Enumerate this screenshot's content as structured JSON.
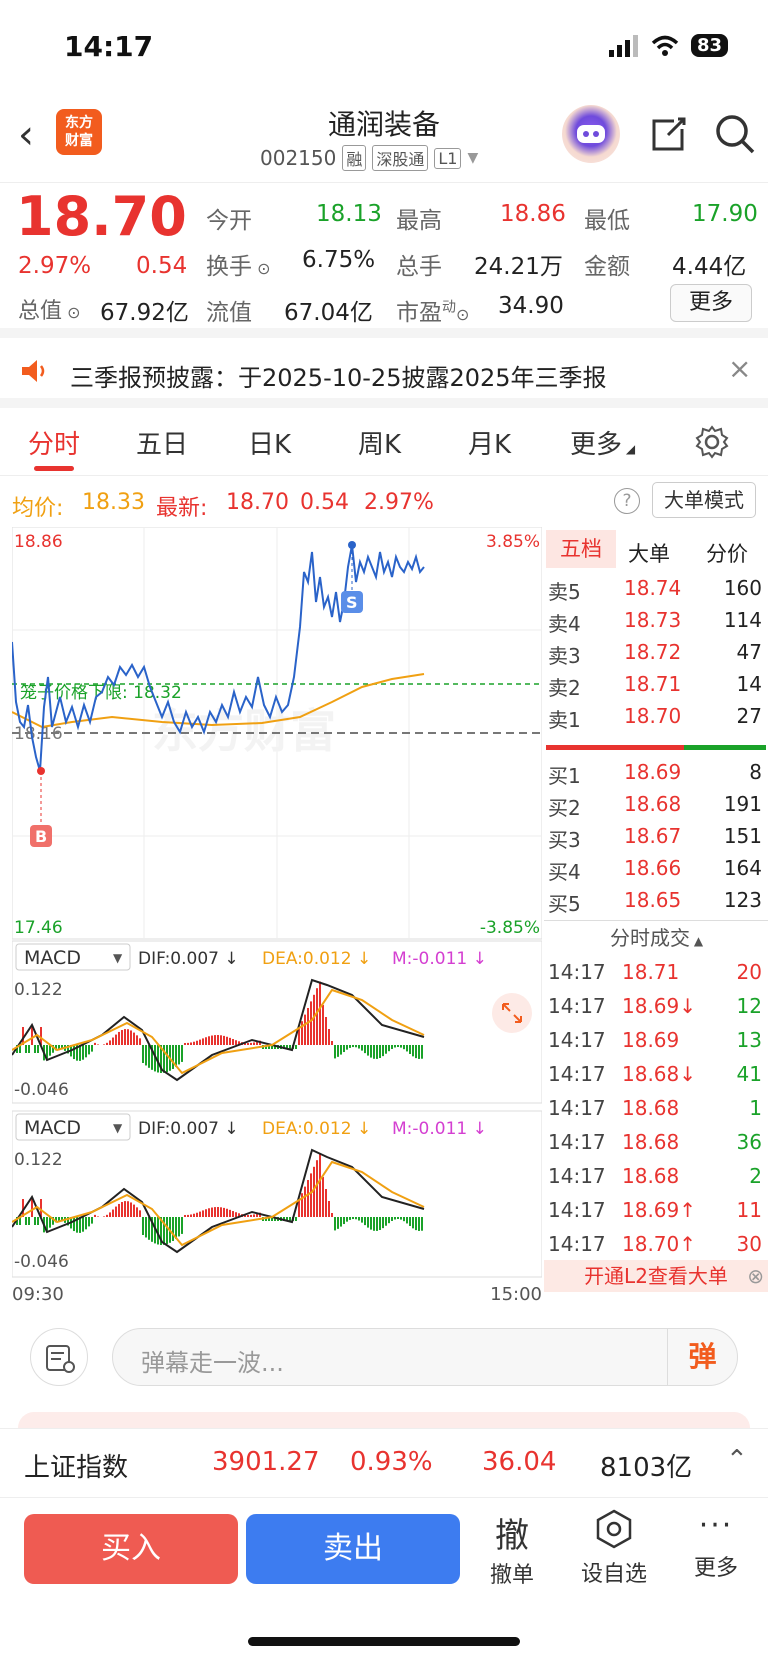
{
  "status": {
    "time": "14:17",
    "battery": "83"
  },
  "header": {
    "logo_line1": "东方",
    "logo_line2": "财富",
    "name": "通润装备",
    "code": "002150",
    "tags": [
      "融",
      "深股通",
      "L1"
    ]
  },
  "quote": {
    "price": "18.70",
    "pct": "2.97%",
    "chg": "0.54",
    "open_label": "今开",
    "open": "18.13",
    "high_label": "最高",
    "high": "18.86",
    "low_label": "最低",
    "low": "17.90",
    "turnover_label": "换手",
    "turnover": "6.75%",
    "volume_label": "总手",
    "volume": "24.21万",
    "amount_label": "金额",
    "amount": "4.44亿",
    "mktcap_label": "总值",
    "mktcap": "67.92亿",
    "float_label": "流值",
    "float": "67.04亿",
    "pe_label": "市盈",
    "pe_sup": "动",
    "pe": "34.90",
    "more": "更多"
  },
  "notice": {
    "text": "三季报预披露：于2025-10-25披露2025年三季报"
  },
  "tabs": [
    "分时",
    "五日",
    "日K",
    "周K",
    "月K",
    "更多"
  ],
  "infoline": {
    "avg_label": "均价:",
    "avg": "18.33",
    "latest_label": "最新:",
    "latest": "18.70",
    "chg": "0.54",
    "pct": "2.97%",
    "mode_btn": "大单模式"
  },
  "chart": {
    "y_top": "18.86",
    "y_bottom": "17.46",
    "pct_top": "3.85%",
    "pct_bottom": "-3.85%",
    "cage_label": "笼子价格下限: 18.32",
    "prev_close": "18.16",
    "watermark": "东方财富",
    "buy_marker": "B",
    "sell_marker": "S",
    "macd": {
      "name": "MACD",
      "dif": "DIF:0.007 ↓",
      "dea": "DEA:0.012 ↓",
      "m": "M:-0.011 ↓",
      "max": "0.122",
      "min": "-0.046"
    },
    "time_start": "09:30",
    "time_end": "15:00",
    "colors": {
      "price": "#2a63c9",
      "avg": "#f0a012",
      "up": "#e8332f",
      "down": "#1aa229"
    }
  },
  "orderbook": {
    "tabs": [
      "五档",
      "大单",
      "分价"
    ],
    "asks": [
      {
        "label": "卖5",
        "price": "18.74",
        "vol": "160"
      },
      {
        "label": "卖4",
        "price": "18.73",
        "vol": "114"
      },
      {
        "label": "卖3",
        "price": "18.72",
        "vol": "47"
      },
      {
        "label": "卖2",
        "price": "18.71",
        "vol": "14"
      },
      {
        "label": "卖1",
        "price": "18.70",
        "vol": "27"
      }
    ],
    "bids": [
      {
        "label": "买1",
        "price": "18.69",
        "vol": "8"
      },
      {
        "label": "买2",
        "price": "18.68",
        "vol": "191"
      },
      {
        "label": "买3",
        "price": "18.67",
        "vol": "151"
      },
      {
        "label": "买4",
        "price": "18.66",
        "vol": "164"
      },
      {
        "label": "买5",
        "price": "18.65",
        "vol": "123"
      }
    ],
    "trades_title": "分时成交",
    "trades": [
      {
        "time": "14:17",
        "price": "18.71",
        "vol": "20",
        "dir": "up"
      },
      {
        "time": "14:17",
        "price": "18.69↓",
        "vol": "12",
        "dir": "down"
      },
      {
        "time": "14:17",
        "price": "18.69",
        "vol": "13",
        "dir": "down"
      },
      {
        "time": "14:17",
        "price": "18.68↓",
        "vol": "41",
        "dir": "down"
      },
      {
        "time": "14:17",
        "price": "18.68",
        "vol": "1",
        "dir": "down"
      },
      {
        "time": "14:17",
        "price": "18.68",
        "vol": "36",
        "dir": "down"
      },
      {
        "time": "14:17",
        "price": "18.68",
        "vol": "2",
        "dir": "down"
      },
      {
        "time": "14:17",
        "price": "18.69↑",
        "vol": "11",
        "dir": "up"
      },
      {
        "time": "14:17",
        "price": "18.70↑",
        "vol": "30",
        "dir": "up"
      }
    ],
    "l2_banner": "开通L2查看大单"
  },
  "comment": {
    "placeholder": "弹幕走一波...",
    "danmu_btn": "弹"
  },
  "index": {
    "name": "上证指数",
    "value": "3901.27",
    "pct": "0.93%",
    "chg": "36.04",
    "amount": "8103亿"
  },
  "bottombar": {
    "buy": "买入",
    "sell": "卖出",
    "cancel_icon_text": "撤",
    "cancel": "撤单",
    "watch": "设自选",
    "more": "更多"
  }
}
